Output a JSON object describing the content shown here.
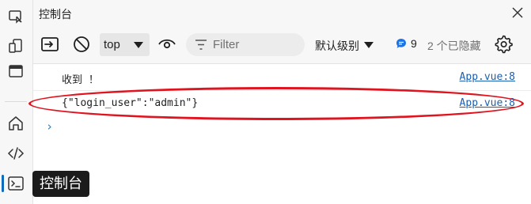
{
  "tooltip": {
    "text": "控制台"
  },
  "titlebar": {
    "title": "控制台"
  },
  "toolbar": {
    "context": "top",
    "filter_placeholder": "Filter",
    "level": "默认级别",
    "issues_count": "9",
    "hidden": "2 个已隐藏"
  },
  "console": {
    "messages": [
      {
        "text": "收到 ！",
        "source": "App.vue:8"
      },
      {
        "text": "{\"login_user\":\"admin\"}",
        "source": "App.vue:8"
      }
    ],
    "prompt": "›"
  },
  "colors": {
    "accent": "#0f6cbd",
    "annotation": "#e0141e",
    "link": "#1a5fb4"
  },
  "icons": [
    "inspect-icon",
    "device-emulation-icon",
    "dock-icon",
    "welcome-home-icon",
    "elements-code-icon",
    "console-icon",
    "close-icon",
    "clear-console-icon",
    "block-icon",
    "eye-icon",
    "filter-icon",
    "issues-icon",
    "settings-gear-icon"
  ]
}
